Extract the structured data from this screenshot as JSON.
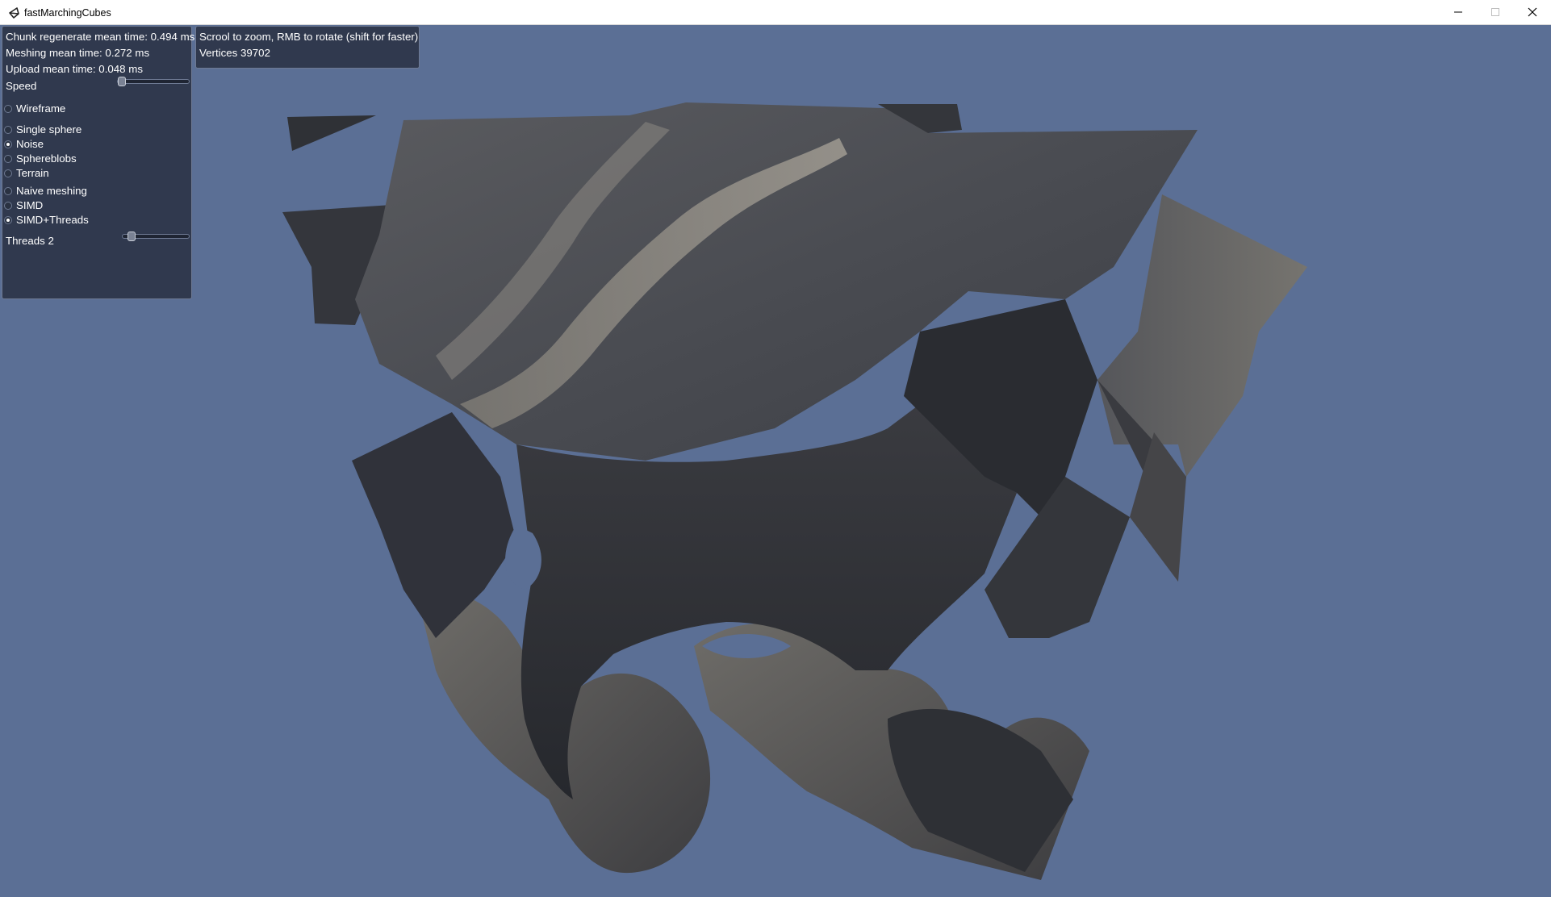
{
  "window": {
    "title": "fastMarchingCubes",
    "controls": [
      "minimize-icon",
      "maximize-icon",
      "close-icon"
    ]
  },
  "stats_panel": {
    "chunk_time": "Chunk regenerate mean time: 0.494 ms",
    "meshing_time": "Meshing mean time: 0.272 ms",
    "upload_time": "Upload mean time: 0.048 ms",
    "speed_label": "Speed",
    "speed_value": 0.0,
    "wireframe_label": "Wireframe",
    "wireframe_checked": false,
    "scene_options": [
      {
        "label": "Single sphere",
        "selected": false
      },
      {
        "label": "Noise",
        "selected": true
      },
      {
        "label": "Sphereblobs",
        "selected": false
      },
      {
        "label": "Terrain",
        "selected": false
      }
    ],
    "meshing_options": [
      {
        "label": "Naive meshing",
        "selected": false
      },
      {
        "label": "SIMD",
        "selected": false
      },
      {
        "label": "SIMD+Threads",
        "selected": true
      }
    ],
    "threads_label": "Threads 2",
    "threads_value": 0.1
  },
  "help_panel": {
    "instructions": "Scrool to zoom, RMB to rotate (shift for faster)",
    "vertices": "Vertices 39702"
  },
  "colors": {
    "background": "#5b6f95",
    "panel": "#2c3448",
    "rock_dark": "#3a3c42",
    "rock_light": "#8a8680"
  }
}
